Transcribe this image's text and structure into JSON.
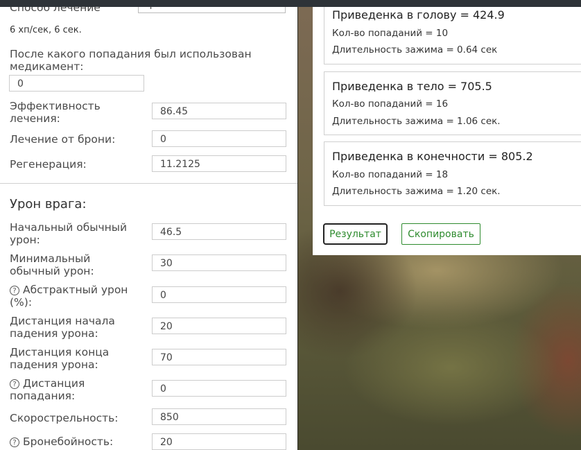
{
  "left_panel": {
    "healing_method": {
      "label": "Способ лечение",
      "selected": "Армейка"
    },
    "heal_rate_text": "6 хп/сек, 6 сек.",
    "medkit_after_hit": {
      "label": "После какого попадания был использован медикамент:",
      "value": "0"
    },
    "heal_efficiency": {
      "label": "Эффективность лечения:",
      "value": "86.45"
    },
    "armor_heal": {
      "label": "Лечение от брони:",
      "value": "0"
    },
    "regeneration": {
      "label": "Регенерация:",
      "value": "11.2125"
    },
    "enemy_damage": {
      "title": "Урон врага:",
      "fields": [
        {
          "label": "Начальный обычный урон:",
          "value": "46.5",
          "help": false
        },
        {
          "label": "Минимальный обычный урон:",
          "value": "30",
          "help": false
        },
        {
          "label": "Абстрактный урон (%):",
          "value": "0",
          "help": true
        },
        {
          "label": "Дистанция начала падения урона:",
          "value": "20",
          "help": false
        },
        {
          "label": "Дистанция конца падения урона:",
          "value": "70",
          "help": false
        },
        {
          "label": "Дистанция попадания:",
          "value": "0",
          "help": true
        },
        {
          "label": "Скорострельность:",
          "value": "850",
          "help": false
        },
        {
          "label": "Бронебойность:",
          "value": "20",
          "help": true
        }
      ]
    }
  },
  "results": {
    "cards": [
      {
        "title": "Приведенка в голову = 424.9",
        "hits": "Кол-во попаданий = 10",
        "hold": "Длительность зажима = 0.64 сек"
      },
      {
        "title": "Приведенка в тело = 705.5",
        "hits": "Кол-во попаданий = 16",
        "hold": "Длительность зажима = 1.06 сек."
      },
      {
        "title": "Приведенка в конечности = 805.2",
        "hits": "Кол-во попаданий = 18",
        "hold": "Длительность зажима = 1.20 сек."
      }
    ],
    "result_button": "Результат",
    "copy_button": "Скопировать"
  },
  "colors": {
    "accent_green": "#2e8b2e",
    "text": "#4a4a4a",
    "border": "#cccccc"
  },
  "icons": {
    "help": "help-circle-icon",
    "dropdown": "chevron-down-icon"
  }
}
